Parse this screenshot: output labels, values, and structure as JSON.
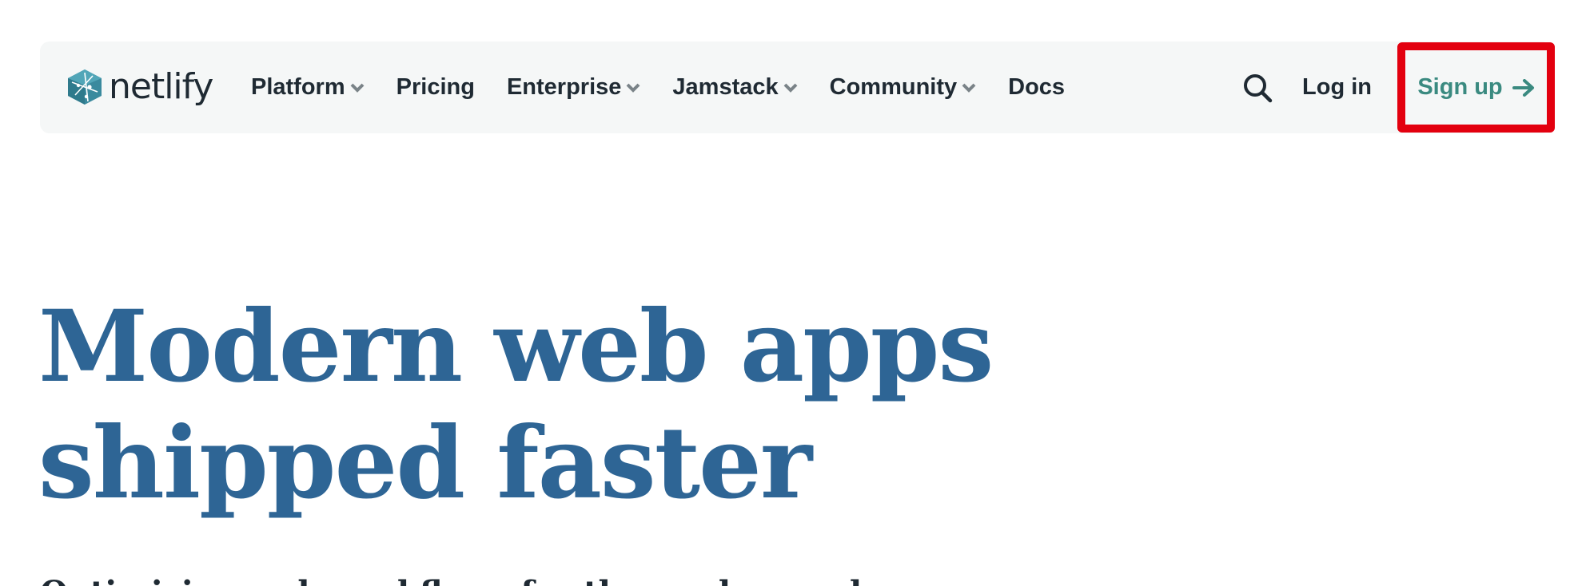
{
  "brand": {
    "name": "netlify",
    "logo_color": "#3a8a9e"
  },
  "nav": {
    "items": [
      {
        "label": "Platform",
        "has_dropdown": true
      },
      {
        "label": "Pricing",
        "has_dropdown": false
      },
      {
        "label": "Enterprise",
        "has_dropdown": true
      },
      {
        "label": "Jamstack",
        "has_dropdown": true
      },
      {
        "label": "Community",
        "has_dropdown": true
      },
      {
        "label": "Docs",
        "has_dropdown": false
      }
    ],
    "search_icon": "search-icon",
    "login_label": "Log in",
    "signup_label": "Sign up",
    "signup_icon": "arrow-right-icon"
  },
  "hero": {
    "title_line1": "Modern web apps",
    "title_line2": "shipped faster",
    "subtitle": "Optimizing web workflows for the modern web"
  },
  "colors": {
    "heading": "#2e6595",
    "text": "#1f2a33",
    "accent": "#3a8a80",
    "highlight": "#e3000f",
    "nav_bg": "#f5f7f7"
  }
}
